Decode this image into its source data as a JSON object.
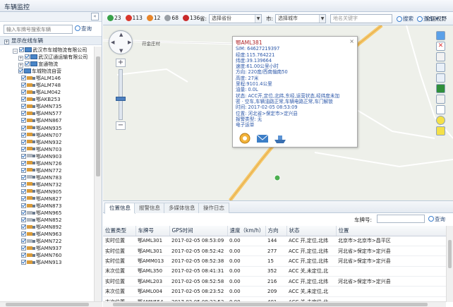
{
  "window": {
    "title": "车辆监控"
  },
  "left": {
    "search_placeholder": "输入车牌号搜索车辆",
    "query_label": "查询",
    "online_label": "显示在线车辆",
    "tree": [
      {
        "label": "武汉市车城物流有限公司",
        "kind": "org",
        "level": 0,
        "expand": "−"
      },
      {
        "label": "武汉辽通运输有限公司",
        "kind": "org",
        "level": 1,
        "expand": "+"
      },
      {
        "label": "宣通物流",
        "kind": "org",
        "level": 1,
        "expand": "+"
      },
      {
        "label": "车城物流自营",
        "kind": "org",
        "level": 1,
        "expand": ""
      },
      {
        "label": "鄂ALM146",
        "kind": "truck",
        "level": 2
      },
      {
        "label": "鄂ALM748",
        "kind": "truck",
        "level": 2
      },
      {
        "label": "鄂ALM042",
        "kind": "truck",
        "level": 2
      },
      {
        "label": "鄂AKB253",
        "kind": "truck",
        "level": 2
      },
      {
        "label": "鄂AMN735",
        "kind": "truck",
        "level": 2
      },
      {
        "label": "鄂AMN577",
        "kind": "truck",
        "level": 2
      },
      {
        "label": "鄂AMN867",
        "kind": "truck",
        "level": 2
      },
      {
        "label": "鄂AMN935",
        "kind": "truck",
        "level": 2
      },
      {
        "label": "鄂AMN707",
        "kind": "truck",
        "level": 2
      },
      {
        "label": "鄂AMN932",
        "kind": "truck",
        "level": 2
      },
      {
        "label": "鄂AMN703",
        "kind": "truck",
        "level": 2
      },
      {
        "label": "鄂AMN903",
        "kind": "truck-off",
        "level": 2
      },
      {
        "label": "鄂AMN726",
        "kind": "truck",
        "level": 2
      },
      {
        "label": "鄂AMN772",
        "kind": "truck",
        "level": 2
      },
      {
        "label": "鄂AMN783",
        "kind": "truck-off",
        "level": 2
      },
      {
        "label": "鄂AMN732",
        "kind": "truck",
        "level": 2
      },
      {
        "label": "鄂AMN905",
        "kind": "truck",
        "level": 2
      },
      {
        "label": "鄂AMN827",
        "kind": "truck",
        "level": 2
      },
      {
        "label": "鄂AMN873",
        "kind": "truck",
        "level": 2
      },
      {
        "label": "鄂AMN965",
        "kind": "truck-off",
        "level": 2
      },
      {
        "label": "鄂AMN852",
        "kind": "truck-off",
        "level": 2
      },
      {
        "label": "鄂AMN892",
        "kind": "truck",
        "level": 2
      },
      {
        "label": "鄂AMN963",
        "kind": "truck",
        "level": 2
      },
      {
        "label": "鄂AMN722",
        "kind": "truck-off",
        "level": 2
      },
      {
        "label": "鄂AMN937",
        "kind": "truck",
        "level": 2
      },
      {
        "label": "鄂AMN760",
        "kind": "truck",
        "level": 2
      },
      {
        "label": "鄂AMN913",
        "kind": "truck",
        "level": 2
      }
    ]
  },
  "toolbar": {
    "counts": [
      {
        "value": "23",
        "color": "#3aa24a",
        "icon": "truck-moving-icon"
      },
      {
        "value": "113",
        "color": "#d9362b",
        "icon": "truck-stopped-icon"
      },
      {
        "value": "12",
        "color": "#e8862a",
        "icon": "truck-alarm-icon"
      },
      {
        "value": "68",
        "color": "#9aa0a6",
        "icon": "truck-offline-icon"
      },
      {
        "value": "136",
        "color": "#c92a2a",
        "icon": "truck-total-icon"
      }
    ],
    "province_label": "省:",
    "province_placeholder": "选择省份",
    "city_label": "市:",
    "city_placeholder": "选择城市",
    "keyword_placeholder": "地名关键字",
    "search_label": "搜索",
    "findcar_label": "查车",
    "fullscreen_label": "全国视野"
  },
  "map": {
    "place_labels": [
      "苻金庄村"
    ],
    "popup": {
      "title": "鄂AML381",
      "lines": [
        "SIM: 64627219397",
        "经度:115.764221",
        "纬度:39.139664",
        "速度:61.00公里小时",
        "方向: 220度/西南偏南50",
        "高度: 27米",
        "里程:9101.4公里",
        "油量: 0.0L",
        "状态: ACC开,定位,北纬,东经,运营状态,经纬度未加",
        "密 · 空车,车辆油路正常,车辆电路正常,车门解锁",
        "时间: 2017-02-05 08:53:09",
        "位置: 河北省>保定市>定兴县",
        "报警类型: 无",
        "电子运单"
      ]
    }
  },
  "bottom": {
    "tabs": [
      "位置信息",
      "报警信息",
      "多媒体信息",
      "操作日志"
    ],
    "plate_label": "车牌号:",
    "query_label": "查询",
    "columns": [
      "位置类型",
      "车牌号",
      "GPS时间",
      "速度（km/h）",
      "方向",
      "状态",
      "位置"
    ],
    "rows": [
      [
        "实时位置",
        "鄂AML301",
        "2017-02-05 08:53:09",
        "0.00",
        "144",
        "ACC 开,定位,北纬",
        "北京市>北京市>昌平区"
      ],
      [
        "实时位置",
        "鄂AML301",
        "2017-02-05 08:52:42",
        "0.00",
        "277",
        "ACC 开,定位,北纬",
        "河北省>保定市>定兴县"
      ],
      [
        "实时位置",
        "鄂AMM013",
        "2017-02-05 08:52:38",
        "0.00",
        "15",
        "ACC 开,定位,北纬",
        "河北省>保定市>定兴县"
      ],
      [
        "末次位置",
        "鄂AML350",
        "2017-02-05 08:41:31",
        "0.00",
        "352",
        "ACC 关,未定位,北",
        ""
      ],
      [
        "实时位置",
        "鄂AML203",
        "2017-02-05 08:52:58",
        "0.00",
        "216",
        "ACC 开,定位,北纬",
        "河北省>保定市>定兴县"
      ],
      [
        "末次位置",
        "鄂AML004",
        "2017-02-05 08:23:52",
        "0.00",
        "209",
        "ACC 关,未定位,北",
        ""
      ],
      [
        "末次位置",
        "鄂AMN554",
        "2017-02-05 08:23:53",
        "0.00",
        "401",
        "ACC 关,未定位,北",
        ""
      ]
    ]
  }
}
